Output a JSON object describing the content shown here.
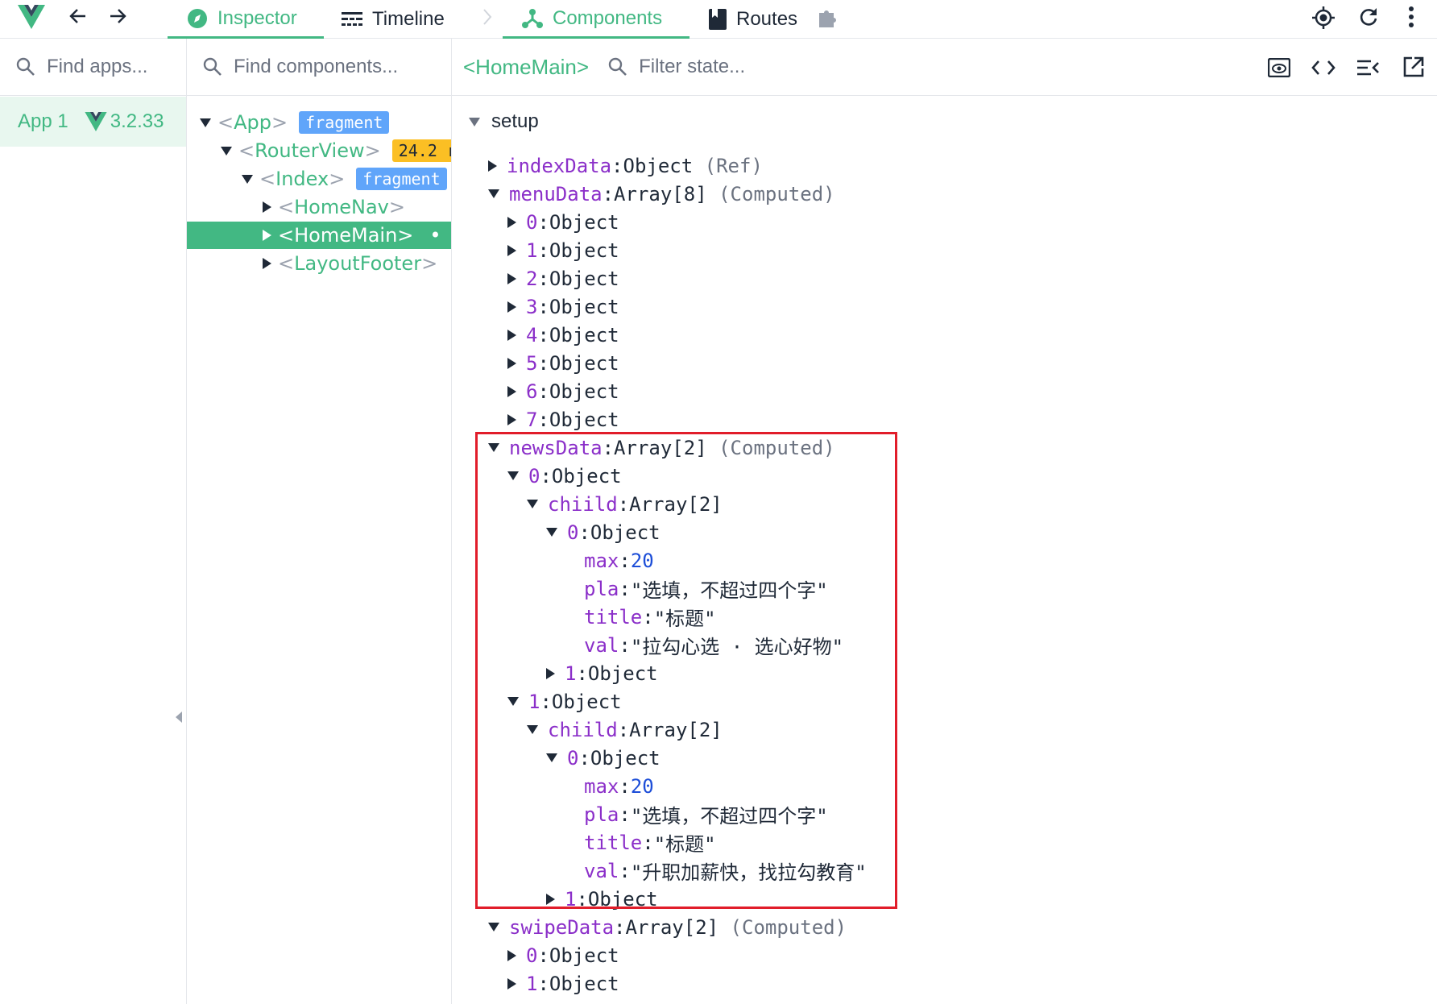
{
  "topbar": {
    "tabs": [
      {
        "label": "Inspector",
        "icon": "compass-icon",
        "active": true
      },
      {
        "label": "Timeline",
        "icon": "timeline-icon",
        "active": false
      },
      {
        "label": "Components",
        "icon": "components-icon",
        "active": true
      },
      {
        "label": "Routes",
        "icon": "book-icon",
        "active": false
      }
    ],
    "icons": [
      "vue-logo-icon",
      "back-arrow-icon",
      "forward-arrow-icon",
      "separator-chevron-icon",
      "puzzle-icon",
      "target-icon",
      "refresh-icon",
      "more-vert-icon"
    ]
  },
  "apps": {
    "search_placeholder": "Find apps...",
    "items": [
      {
        "label": "App 1",
        "version": "3.2.33"
      }
    ]
  },
  "components": {
    "search_placeholder": "Find components...",
    "tree": [
      {
        "name": "App",
        "badge": "fragment"
      },
      {
        "name": "RouterView",
        "badge": "24.2 r"
      },
      {
        "name": "Index",
        "badge": "fragment"
      },
      {
        "name": "HomeNav"
      },
      {
        "name": "HomeMain",
        "dot": "•"
      },
      {
        "name": "LayoutFooter"
      }
    ]
  },
  "state": {
    "component_name": "<HomeMain>",
    "filter_placeholder": "Filter state...",
    "section": "setup",
    "rows": [
      {
        "k": "indexData",
        "v": "Object",
        "t": "(Ref)"
      },
      {
        "k": "menuData",
        "v": "Array[8]",
        "t": "(Computed)"
      },
      {
        "k": "0",
        "v": "Object"
      },
      {
        "k": "1",
        "v": "Object"
      },
      {
        "k": "2",
        "v": "Object"
      },
      {
        "k": "3",
        "v": "Object"
      },
      {
        "k": "4",
        "v": "Object"
      },
      {
        "k": "5",
        "v": "Object"
      },
      {
        "k": "6",
        "v": "Object"
      },
      {
        "k": "7",
        "v": "Object"
      },
      {
        "k": "newsData",
        "v": "Array[2]",
        "t": "(Computed)"
      },
      {
        "k": "0",
        "v": "Object"
      },
      {
        "k": "chiild",
        "v": "Array[2]"
      },
      {
        "k": "0",
        "v": "Object"
      },
      {
        "k": "max",
        "v": "20"
      },
      {
        "k": "pla",
        "v": "\"选填，不超过四个字\""
      },
      {
        "k": "title",
        "v": "\"标题\""
      },
      {
        "k": "val",
        "v": "\"拉勾心选 · 选心好物\""
      },
      {
        "k": "1",
        "v": "Object"
      },
      {
        "k": "1",
        "v": "Object"
      },
      {
        "k": "chiild",
        "v": "Array[2]"
      },
      {
        "k": "0",
        "v": "Object"
      },
      {
        "k": "max",
        "v": "20"
      },
      {
        "k": "pla",
        "v": "\"选填，不超过四个字\""
      },
      {
        "k": "title",
        "v": "\"标题\""
      },
      {
        "k": "val",
        "v": "\"升职加薪快，找拉勾教育\""
      },
      {
        "k": "1",
        "v": "Object"
      },
      {
        "k": "swipeData",
        "v": "Array[2]",
        "t": "(Computed)"
      },
      {
        "k": "0",
        "v": "Object"
      },
      {
        "k": "1",
        "v": "Object"
      }
    ]
  },
  "colors": {
    "accent": "#42b883",
    "key": "#8b2fc9",
    "number": "#1d4ed8",
    "highlight": "#e11d2a"
  }
}
